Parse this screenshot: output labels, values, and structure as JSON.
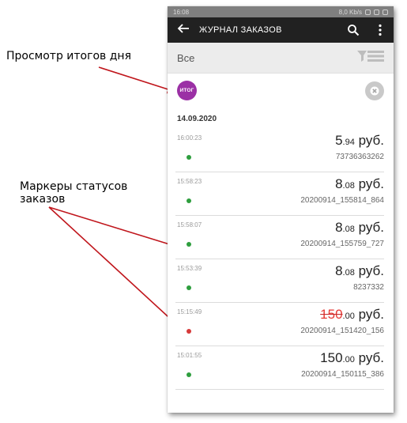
{
  "annotations": {
    "totals_label": "Просмотр итогов дня",
    "status_label_line1": "Маркеры статусов",
    "status_label_line2": "заказов"
  },
  "statusbar": {
    "time": "16:08",
    "indicators": "8,0 Kb/s"
  },
  "appbar": {
    "title": "ЖУРНАЛ ЗАКАЗОВ",
    "icons": [
      "back-arrow-icon",
      "search-icon",
      "more-vert-icon"
    ]
  },
  "filter": {
    "label": "Все",
    "icon": "filter-icon"
  },
  "totals_button": {
    "label": "ИТОГ",
    "color": "#9b30a5"
  },
  "clear_icon": "close-circle-icon",
  "date": "14.09.2020",
  "colors": {
    "status_ok": "#2e9e3e",
    "status_cancelled": "#d63a3a",
    "cancelled_amount": "#e53935"
  },
  "orders": [
    {
      "time": "16:00:23",
      "amount_int": "5",
      "amount_frac": ".94",
      "currency": "руб.",
      "number": "73736363262",
      "status": "ok"
    },
    {
      "time": "15:58:23",
      "amount_int": "8",
      "amount_frac": ".08",
      "currency": "руб.",
      "number": "20200914_155814_864",
      "status": "ok"
    },
    {
      "time": "15:58:07",
      "amount_int": "8",
      "amount_frac": ".08",
      "currency": "руб.",
      "number": "20200914_155759_727",
      "status": "ok"
    },
    {
      "time": "15:53:39",
      "amount_int": "8",
      "amount_frac": ".08",
      "currency": "руб.",
      "number": "8237332",
      "status": "ok"
    },
    {
      "time": "15:15:49",
      "amount_int": "150",
      "amount_frac": ".00",
      "currency": "руб.",
      "number": "20200914_151420_156",
      "status": "cancelled"
    },
    {
      "time": "15:01:55",
      "amount_int": "150",
      "amount_frac": ".00",
      "currency": "руб.",
      "number": "20200914_150115_386",
      "status": "ok"
    }
  ]
}
